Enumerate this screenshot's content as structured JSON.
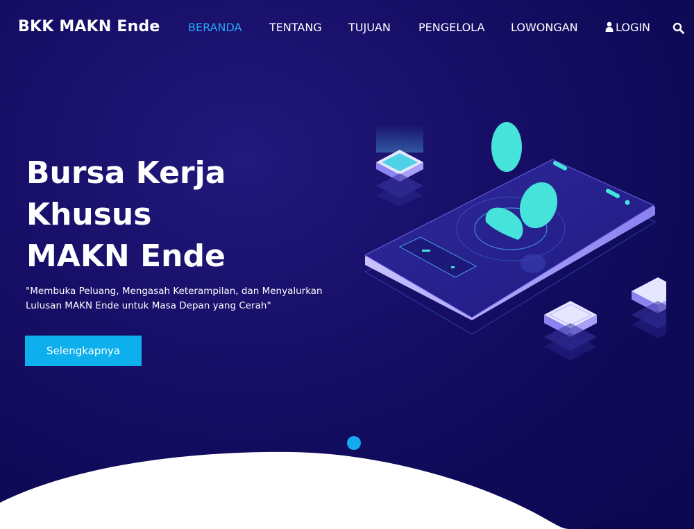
{
  "nav": {
    "brand": "BKK MAKN Ende",
    "items": [
      {
        "label": "BERANDA",
        "active": true
      },
      {
        "label": "TENTANG"
      },
      {
        "label": "TUJUAN"
      },
      {
        "label": "PENGELOLA"
      },
      {
        "label": "LOWONGAN"
      },
      {
        "label": "LOGIN",
        "icon": "user-icon"
      }
    ],
    "search_icon": "search-icon"
  },
  "hero": {
    "title_lines": [
      "Bursa Kerja",
      "Khusus",
      "MAKN Ende"
    ],
    "subtitle": "\"Membuka Peluang, Mengasah Keterampilan, dan Menyalurkan Lulusan MAKN Ende untuk Masa Depan yang Cerah\"",
    "button_label": "Selengkapnya"
  },
  "colors": {
    "background": "#140d63",
    "accent": "#0db0ec",
    "active_nav": "#2ba8f4",
    "teal": "#45e3d9"
  }
}
